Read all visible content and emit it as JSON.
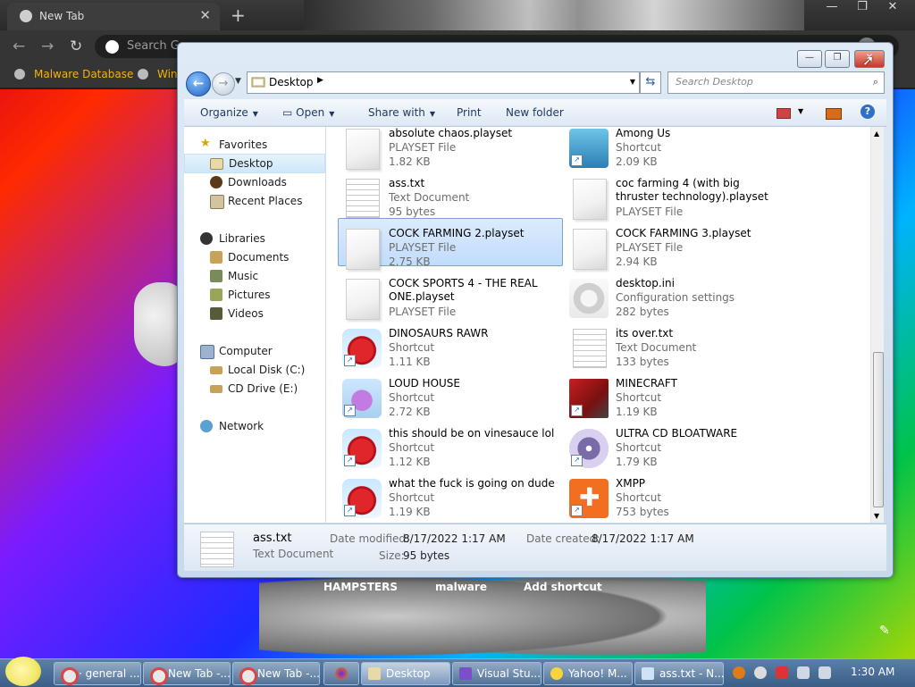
{
  "browser": {
    "tab_title": "New Tab",
    "tab_close": "✕",
    "new_tab": "+",
    "omnibox_placeholder": "Search G",
    "bookmarks": [
      "Malware Database",
      "Win"
    ],
    "ntp_shortcuts": [
      "HAMPSTERS",
      "malware",
      "Add shortcut"
    ]
  },
  "explorer": {
    "address": "Desktop",
    "search_placeholder": "Search Desktop",
    "commands": {
      "organize": "Organize",
      "open": "Open",
      "share_with": "Share with",
      "print": "Print",
      "new_folder": "New folder"
    },
    "nav": {
      "favorites": "Favorites",
      "desktop": "Desktop",
      "downloads": "Downloads",
      "recent_places": "Recent Places",
      "libraries": "Libraries",
      "documents": "Documents",
      "music": "Music",
      "pictures": "Pictures",
      "videos": "Videos",
      "computer": "Computer",
      "local_disk": "Local Disk (C:)",
      "cd_drive": "CD Drive (E:)",
      "network": "Network"
    },
    "files": [
      {
        "name": "absolute chaos.playset",
        "type": "PLAYSET File",
        "size": "1.82 KB"
      },
      {
        "name": "Among Us",
        "type": "Shortcut",
        "size": "2.09 KB"
      },
      {
        "name": "ass.txt",
        "type": "Text Document",
        "size": "95 bytes"
      },
      {
        "name": "coc farming 4 (with big thruster technology).playset",
        "type": "PLAYSET File",
        "size": ""
      },
      {
        "name": "COCK FARMING 2.playset",
        "type": "PLAYSET File",
        "size": "2.75 KB"
      },
      {
        "name": "COCK FARMING 3.playset",
        "type": "PLAYSET File",
        "size": "2.94 KB"
      },
      {
        "name": "COCK SPORTS 4 - THE REAL ONE.playset",
        "type": "PLAYSET File",
        "size": ""
      },
      {
        "name": "desktop.ini",
        "type": "Configuration settings",
        "size": "282 bytes"
      },
      {
        "name": "DINOSAURS RAWR",
        "type": "Shortcut",
        "size": "1.11 KB"
      },
      {
        "name": "its over.txt",
        "type": "Text Document",
        "size": "133 bytes"
      },
      {
        "name": "LOUD HOUSE",
        "type": "Shortcut",
        "size": "2.72 KB"
      },
      {
        "name": "MINECRAFT",
        "type": "Shortcut",
        "size": "1.19 KB"
      },
      {
        "name": "this should be on vinesauce lol",
        "type": "Shortcut",
        "size": "1.12 KB"
      },
      {
        "name": "ULTRA CD BLOATWARE",
        "type": "Shortcut",
        "size": "1.79 KB"
      },
      {
        "name": "what the fuck is going on dude",
        "type": "Shortcut",
        "size": "1.19 KB"
      },
      {
        "name": "XMPP",
        "type": "Shortcut",
        "size": "753 bytes"
      }
    ],
    "details": {
      "name": "ass.txt",
      "type": "Text Document",
      "date_modified_label": "Date modified:",
      "date_modified": "8/17/2022 1:17 AM",
      "date_created_label": "Date created:",
      "date_created": "8/17/2022 1:17 AM",
      "size_label": "Size:",
      "size": "95 bytes"
    }
  },
  "taskbar": {
    "buttons": [
      "· general ...",
      "New Tab -...",
      "New Tab -...",
      "",
      "Desktop",
      "Visual Stu...",
      "Yahoo! M...",
      "ass.txt - N..."
    ],
    "clock": "1:30 AM"
  }
}
